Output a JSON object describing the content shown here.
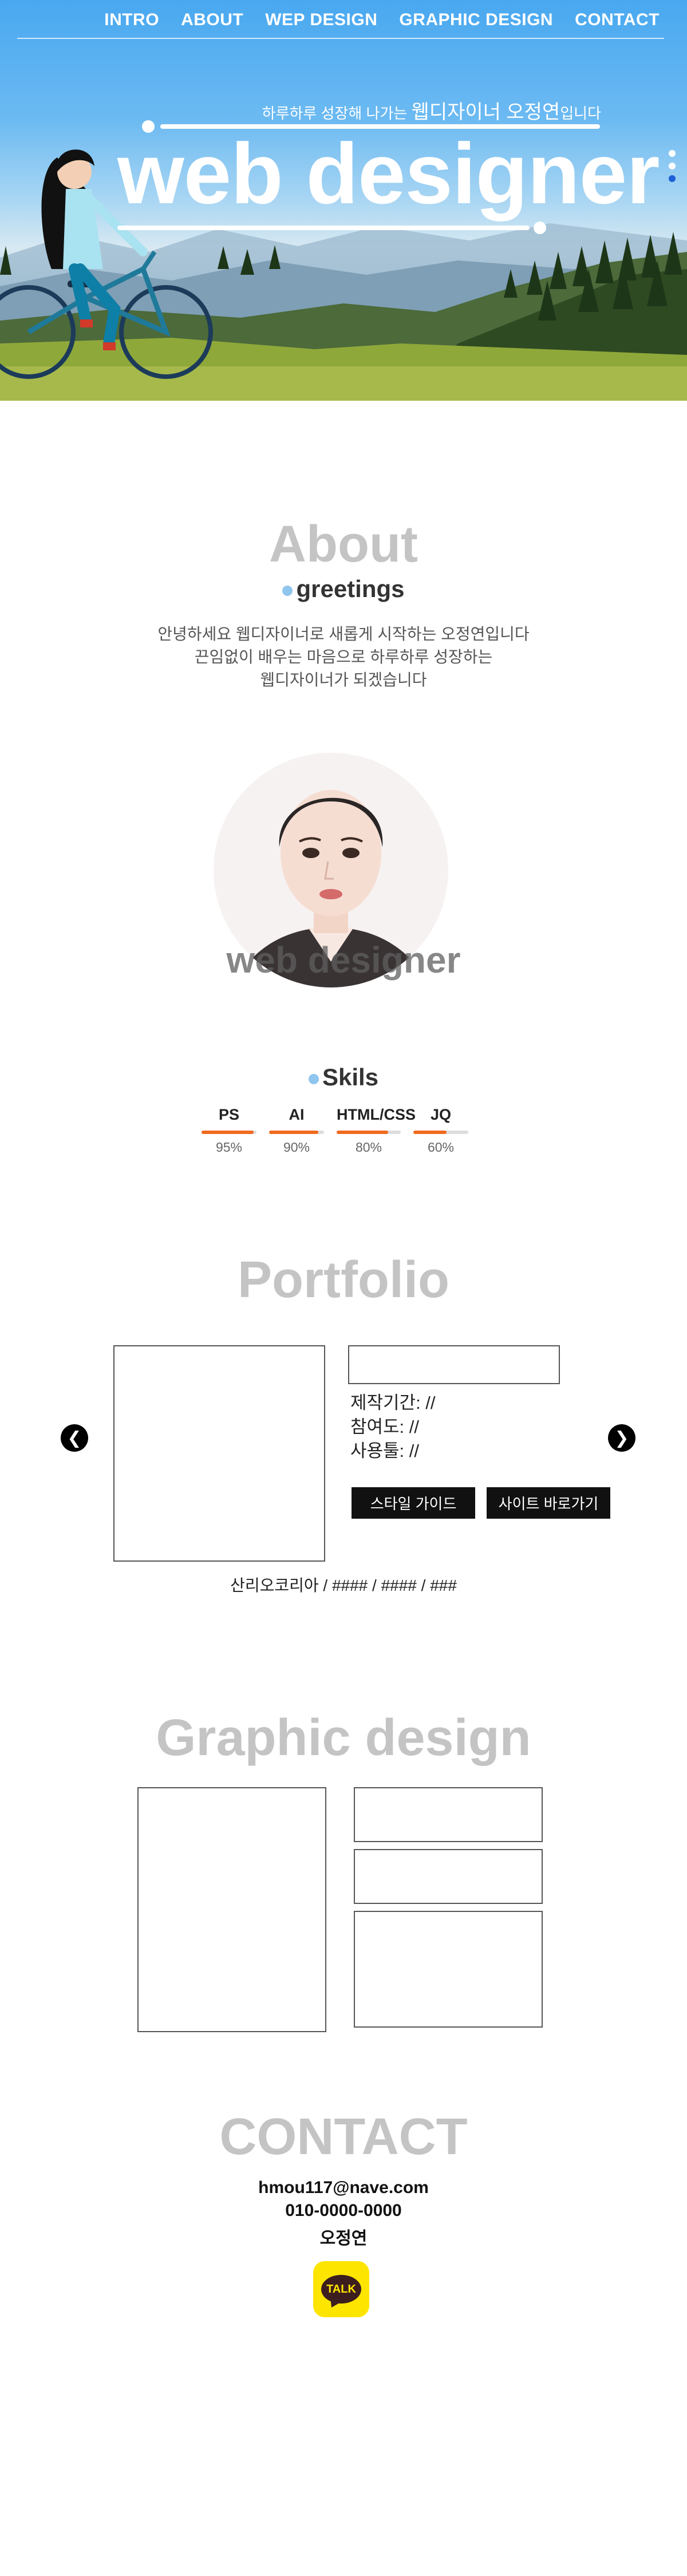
{
  "nav": {
    "items": [
      "INTRO",
      "ABOUT",
      "WEP DESIGN",
      "GRAPHIC DESIGN",
      "CONTACT"
    ]
  },
  "hero": {
    "subtitle_prefix": "하루하루 성장해 나가는",
    "subtitle_name": "웹디자이너 오정연",
    "subtitle_suffix": "입니다",
    "title": "web designer"
  },
  "about": {
    "title": "About",
    "subtitle": "greetings",
    "lines": [
      "안녕하세요 웹디자이너로 새롭게 시작하는 오정연입니다",
      "끈임없이 배우는 마음으로 하루하루 성장하는",
      "웹디자이너가 되겠습니다"
    ],
    "portrait_caption": "web designer"
  },
  "skills": {
    "title": "Skils",
    "items": [
      {
        "name": "PS",
        "value": "95%",
        "level": 95
      },
      {
        "name": "AI",
        "value": "90%",
        "level": 90
      },
      {
        "name": "HTML/CSS",
        "value": "80%",
        "level": 80
      },
      {
        "name": "JQ",
        "value": "60%",
        "level": 60
      }
    ],
    "bar_color": "#f06a1f"
  },
  "portfolio": {
    "title": "Portfolio",
    "period": "제작기간: //",
    "participation": "참여도: //",
    "tools": "사용툴: //",
    "style_guide_button": "스타일 가이드",
    "site_button": "사이트 바로가기",
    "caption": "산리오코리아 / #### / #### / ###",
    "prev_arrow": "❮",
    "next_arrow": "❯"
  },
  "graphic": {
    "title": "Graphic design"
  },
  "contact": {
    "title": "CONTACT",
    "email": "hmou117@nave.com",
    "phone": "010-0000-0000",
    "name": "오정연",
    "talk_label": "TALK"
  },
  "colors": {
    "title_gray": "#c4c4c4",
    "accent_bullet": "#8fc6ee",
    "side_dot_active": "#1f5fd6",
    "kakao_yellow": "#fee500"
  }
}
